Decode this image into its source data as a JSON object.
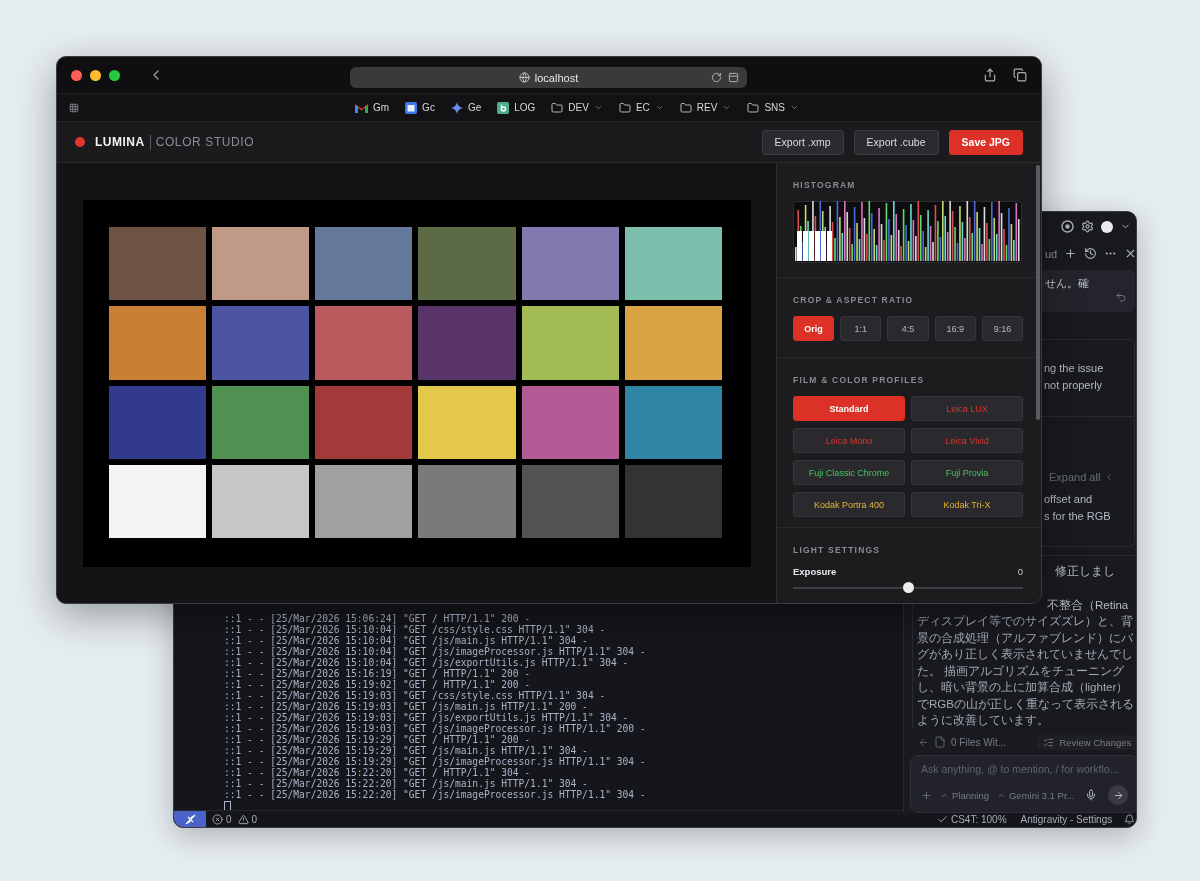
{
  "browser": {
    "url": "localhost",
    "bookmarks": [
      {
        "label": "Gm",
        "kind": "mail"
      },
      {
        "label": "Gc",
        "kind": "calendar"
      },
      {
        "label": "Ge",
        "kind": "spark"
      },
      {
        "label": "LOG",
        "kind": "log"
      },
      {
        "label": "DEV",
        "kind": "folder"
      },
      {
        "label": "EC",
        "kind": "folder"
      },
      {
        "label": "REV",
        "kind": "folder"
      },
      {
        "label": "SNS",
        "kind": "folder"
      }
    ]
  },
  "app": {
    "brand": "LUMINA",
    "subtitle": "COLOR STUDIO",
    "actions": [
      {
        "label": "Export .xmp",
        "primary": false
      },
      {
        "label": "Export .cube",
        "primary": false
      },
      {
        "label": "Save JPG",
        "primary": true
      }
    ],
    "swatches": [
      {
        "color": "#6e5244"
      },
      {
        "color": "#c09a86"
      },
      {
        "color": "#64789c"
      },
      {
        "color": "#5c6b46"
      },
      {
        "color": "#8279b0"
      },
      {
        "color": "#7dbfad"
      },
      {
        "color": "#c98035"
      },
      {
        "color": "#4c55a3"
      },
      {
        "color": "#bb5a5e"
      },
      {
        "color": "#58346a"
      },
      {
        "color": "#a2bb52"
      },
      {
        "color": "#d9a444"
      },
      {
        "color": "#313a8d"
      },
      {
        "color": "#4e9150"
      },
      {
        "color": "#a33a3a"
      },
      {
        "color": "#e4c84a"
      },
      {
        "color": "#b35b94"
      },
      {
        "color": "#2f86a4"
      },
      {
        "color": "#f3f3f1"
      },
      {
        "color": "#c6c6c6"
      },
      {
        "color": "#a0a0a0"
      },
      {
        "color": "#7a7a7a"
      },
      {
        "color": "#535353"
      },
      {
        "color": "#333333"
      }
    ],
    "panel": {
      "histogram": {
        "title": "HISTOGRAM"
      },
      "crop": {
        "title": "CROP & ASPECT RATIO",
        "options": [
          {
            "label": "Orig",
            "selected": true
          },
          {
            "label": "1:1",
            "selected": false
          },
          {
            "label": "4:5",
            "selected": false
          },
          {
            "label": "16:9",
            "selected": false
          },
          {
            "label": "9:16",
            "selected": false
          }
        ]
      },
      "profiles": {
        "title": "FILM & COLOR PROFILES",
        "options": [
          {
            "label": "Standard",
            "selected": true,
            "kind": "standard"
          },
          {
            "label": "Leica LUX",
            "selected": false,
            "kind": "leica"
          },
          {
            "label": "Leica Mono",
            "selected": false,
            "kind": "leica"
          },
          {
            "label": "Leica Vivid",
            "selected": false,
            "kind": "leica"
          },
          {
            "label": "Fuji Classic Chrome",
            "selected": false,
            "kind": "fuji"
          },
          {
            "label": "Fuji Provia",
            "selected": false,
            "kind": "fuji"
          },
          {
            "label": "Kodak Portra 400",
            "selected": false,
            "kind": "kodak"
          },
          {
            "label": "Kodak Tri-X",
            "selected": false,
            "kind": "kodak"
          }
        ]
      },
      "light": {
        "title": "LIGHT SETTINGS",
        "sliders": [
          {
            "label": "Exposure",
            "reading": "0",
            "level": 0.5
          }
        ]
      }
    }
  },
  "ide": {
    "terminal_lines": [
      "::1 - - [25/Mar/2026 15:06:24] \"GET / HTTP/1.1\" 200 -",
      "::1 - - [25/Mar/2026 15:10:04] \"GET /css/style.css HTTP/1.1\" 304 -",
      "::1 - - [25/Mar/2026 15:10:04] \"GET /js/main.js HTTP/1.1\" 304 -",
      "::1 - - [25/Mar/2026 15:10:04] \"GET /js/imageProcessor.js HTTP/1.1\" 304 -",
      "::1 - - [25/Mar/2026 15:10:04] \"GET /js/exportUtils.js HTTP/1.1\" 304 -",
      "::1 - - [25/Mar/2026 15:16:19] \"GET / HTTP/1.1\" 200 -",
      "::1 - - [25/Mar/2026 15:19:02] \"GET / HTTP/1.1\" 200 -",
      "::1 - - [25/Mar/2026 15:19:03] \"GET /css/style.css HTTP/1.1\" 304 -",
      "::1 - - [25/Mar/2026 15:19:03] \"GET /js/main.js HTTP/1.1\" 200 -",
      "::1 - - [25/Mar/2026 15:19:03] \"GET /js/exportUtils.js HTTP/1.1\" 304 -",
      "::1 - - [25/Mar/2026 15:19:03] \"GET /js/imageProcessor.js HTTP/1.1\" 200 -",
      "::1 - - [25/Mar/2026 15:19:29] \"GET / HTTP/1.1\" 200 -",
      "::1 - - [25/Mar/2026 15:19:29] \"GET /js/main.js HTTP/1.1\" 304 -",
      "::1 - - [25/Mar/2026 15:19:29] \"GET /js/imageProcessor.js HTTP/1.1\" 304 -",
      "::1 - - [25/Mar/2026 15:22:20] \"GET / HTTP/1.1\" 304 -",
      "::1 - - [25/Mar/2026 15:22:20] \"GET /js/main.js HTTP/1.1\" 304 -",
      "::1 - - [25/Mar/2026 15:22:20] \"GET /js/imageProcessor.js HTTP/1.1\" 304 -"
    ],
    "assistant": {
      "tab_title": "ud",
      "user_message": "せん。確",
      "step_lines": [
        "ng the issue",
        "not properly"
      ],
      "expand_label": "Expand all",
      "summary_lines": [
        "offset and",
        "s for the RGB"
      ],
      "reply_fragments": [
        "修正しまし",
        "不整合（Retina"
      ],
      "reply_lines": [
        "ディスプレイ等でのサイズズレ）と、背",
        "景の合成処理（アルファブレンド）にバ",
        "グがあり正しく表示されていませんでし",
        "た。 描画アルゴリズムをチューニング",
        "し、暗い背景の上に加算合成（lighter）",
        "でRGBの山が正しく重なって表示される",
        "ように改善しています。"
      ],
      "files_label": "0 Files Wit...",
      "review_label": "Review Changes",
      "input_placeholder": "Ask anything, @ to mention, / for workflo...",
      "mode": "Planning",
      "model": "Gemini 3.1 Pr..."
    },
    "status_bar": {
      "errors": "0",
      "warnings": "0",
      "coverage": "CS4T: 100%",
      "settings": "Antigravity - Settings"
    }
  }
}
